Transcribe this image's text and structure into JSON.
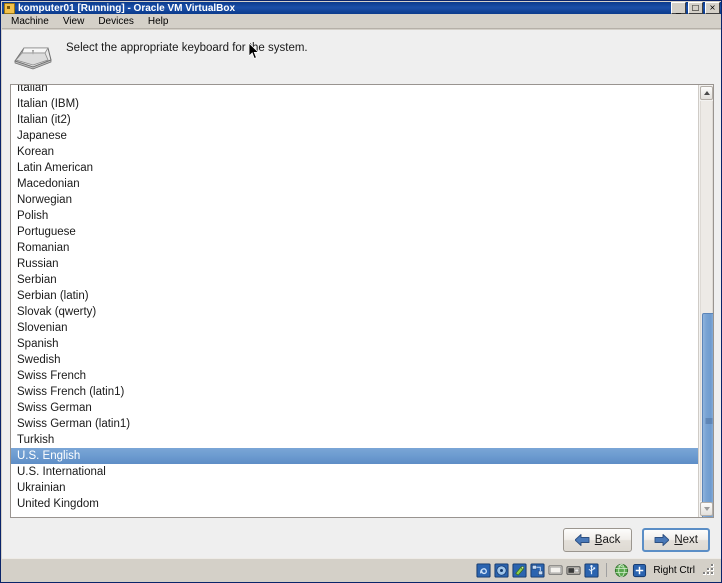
{
  "window": {
    "title": "komputer01 [Running] - Oracle VM VirtualBox",
    "icon": "virtualbox-icon",
    "controls": {
      "minimize": "_",
      "maximize": "□",
      "close": "×"
    }
  },
  "menubar": {
    "items": [
      {
        "label": "Machine"
      },
      {
        "label": "View"
      },
      {
        "label": "Devices"
      },
      {
        "label": "Help"
      }
    ]
  },
  "installer": {
    "header": {
      "icon": "keyboard-key-icon",
      "text": "Select the appropriate keyboard for the system."
    },
    "keyboard_list": {
      "selected": "U.S. English",
      "items": [
        "Italian",
        "Italian (IBM)",
        "Italian (it2)",
        "Japanese",
        "Korean",
        "Latin American",
        "Macedonian",
        "Norwegian",
        "Polish",
        "Portuguese",
        "Romanian",
        "Russian",
        "Serbian",
        "Serbian (latin)",
        "Slovak (qwerty)",
        "Slovenian",
        "Spanish",
        "Swedish",
        "Swiss French",
        "Swiss French (latin1)",
        "Swiss German",
        "Swiss German (latin1)",
        "Turkish",
        "U.S. English",
        "U.S. International",
        "Ukrainian",
        "United Kingdom"
      ]
    },
    "buttons": {
      "back": {
        "label": "Back",
        "mnemonic": "B",
        "icon": "arrow-left-icon",
        "focused": false
      },
      "next": {
        "label": "Next",
        "mnemonic": "N",
        "icon": "arrow-right-icon",
        "focused": true
      }
    }
  },
  "statusbar": {
    "icons": [
      "hard-disk-icon",
      "cd-dvd-icon",
      "floppy-icon",
      "network-icon",
      "shared-folders-icon",
      "display-icon",
      "usb-icon"
    ],
    "right_icons": [
      "globe-icon",
      "host-key-icon"
    ],
    "host_key_label": "Right Ctrl"
  },
  "colors": {
    "titlebar": "#0a3a8c",
    "selection": "#6c9bd0",
    "chrome": "#d4d0c8",
    "guest_bg": "#efefef",
    "accent": "#5b8ec6"
  }
}
